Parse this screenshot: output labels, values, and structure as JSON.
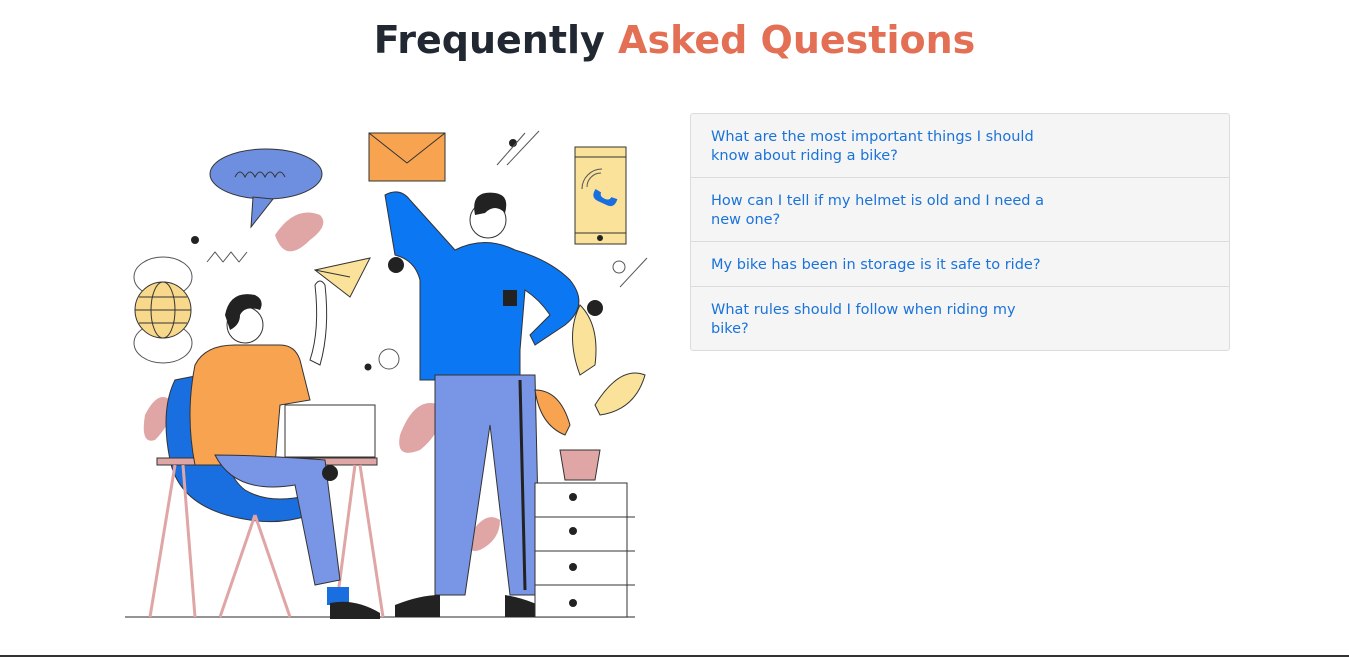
{
  "heading": {
    "part1": "Frequently ",
    "part2": "Asked Questions"
  },
  "faq": {
    "items": [
      {
        "question": "What are the most important things I should know about riding a bike?"
      },
      {
        "question": "How can I tell if my helmet is old and I need a new one?"
      },
      {
        "question": "My bike has been in storage is it safe to ride?"
      },
      {
        "question": "What rules should I follow when riding my bike?"
      }
    ]
  },
  "colors": {
    "accent": "#e36f55",
    "link": "#1a73d9",
    "heading": "#222831"
  }
}
